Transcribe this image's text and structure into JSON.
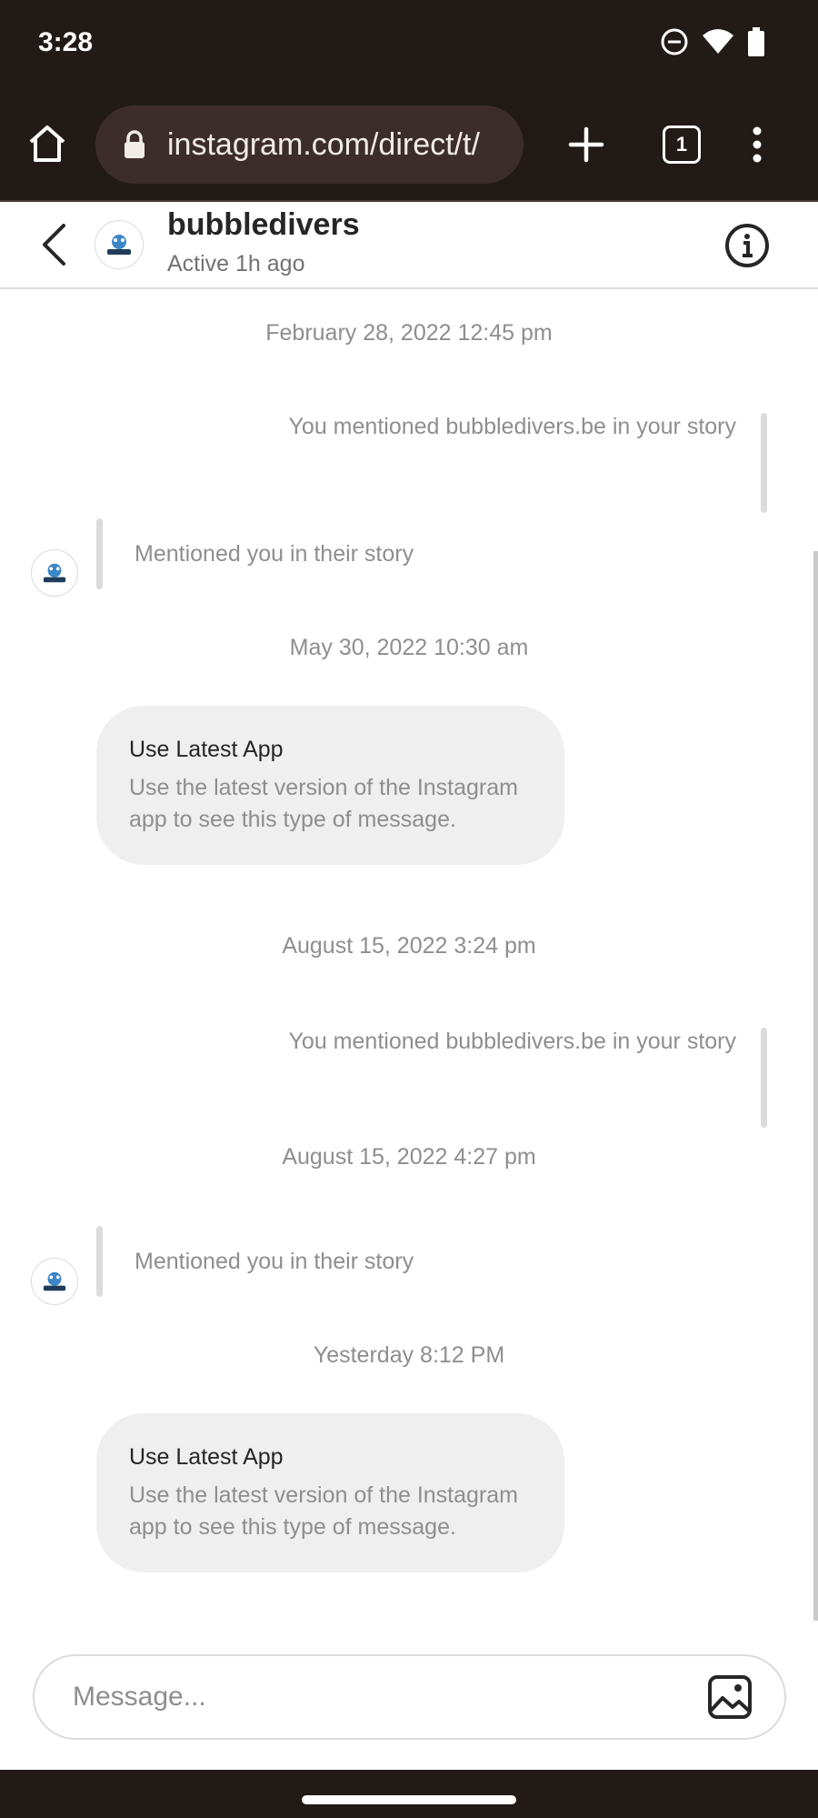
{
  "status_bar": {
    "time": "3:28"
  },
  "browser": {
    "url": "instagram.com/direct/t/",
    "tab_count": "1"
  },
  "header": {
    "name": "bubbledivers",
    "status": "Active 1h ago"
  },
  "messages": {
    "ts1": "February 28, 2022 12:45 pm",
    "mention_out_1": "You mentioned bubbledivers.be in your story",
    "mention_in_1": "Mentioned you in their story",
    "ts2": "May 30, 2022 10:30 am",
    "bubble1_title": "Use Latest App",
    "bubble1_body": "Use the latest version of the Instagram app to see this type of message.",
    "ts3": "August 15, 2022 3:24 pm",
    "mention_out_2": "You mentioned bubbledivers.be in your story",
    "ts4": "August 15, 2022 4:27 pm",
    "mention_in_2": "Mentioned you in their story",
    "ts5": "Yesterday 8:12 PM",
    "bubble2_title": "Use Latest App",
    "bubble2_body": "Use the latest version of the Instagram app to see this type of message."
  },
  "composer": {
    "placeholder": "Message..."
  },
  "colors": {
    "chrome": "#221a17",
    "url_pill": "#3c2d2a",
    "bubble": "#efefef",
    "muted_text": "#8e8e8e"
  },
  "icons": [
    "home-icon",
    "lock-icon",
    "plus-icon",
    "tabs-icon",
    "menu-icon",
    "back-icon",
    "info-icon",
    "image-icon",
    "dnd-icon",
    "wifi-icon",
    "battery-icon"
  ]
}
